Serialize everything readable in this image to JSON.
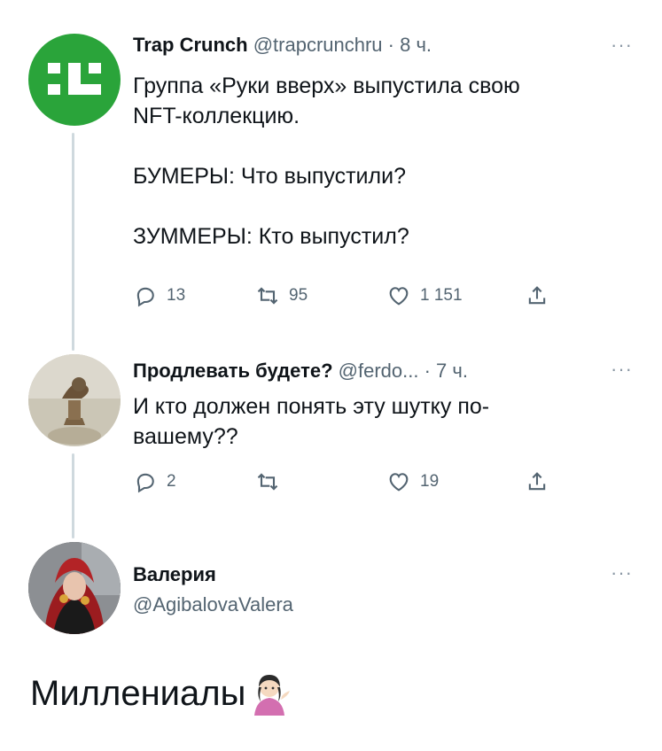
{
  "tweets": [
    {
      "name": "Trap Crunch",
      "handle": "@trapcrunchru",
      "time": "· 8 ч.",
      "text": "Группа «Руки вверх» выпустила свою\nNFT-коллекцию.\n\nБУМЕРЫ: Что выпустили?\n\nЗУММЕРЫ: Кто выпустил?",
      "replies": "13",
      "retweets": "95",
      "likes": "1 151",
      "avatar_icon": "trap-crunch-logo-icon",
      "avatar_color": "#2aa43a"
    },
    {
      "name": "Продлевать будете?",
      "handle": "@ferdo...",
      "time": "· 7 ч.",
      "text": "И кто должен понять эту шутку по-\nвашему??",
      "replies": "2",
      "retweets": "",
      "likes": "19"
    },
    {
      "name": "Валерия",
      "handle": "@AgibalovaValera"
    }
  ],
  "more_label": "···",
  "caption": "Миллениалы",
  "caption_emoji": "person-tipping-hand-emoji"
}
